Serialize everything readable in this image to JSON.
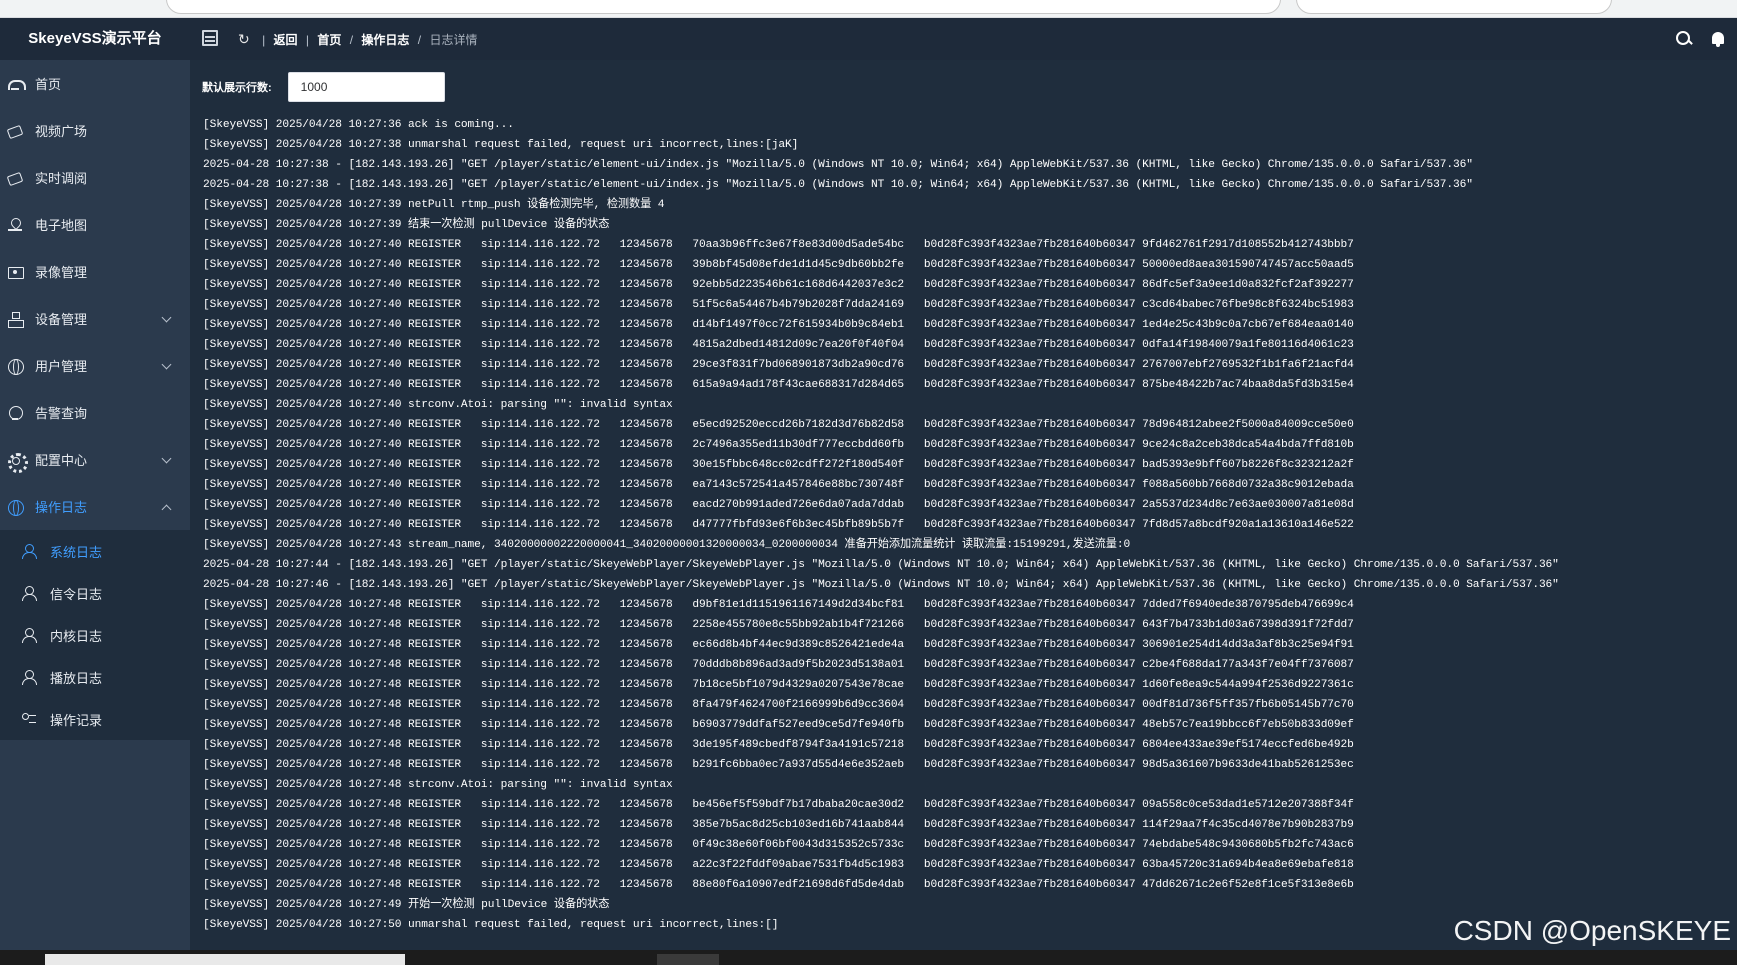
{
  "app": {
    "title": "SkeyeVSS演示平台"
  },
  "breadcrumb": {
    "back": "返回",
    "home": "首页",
    "section": "操作日志",
    "current": "日志详情",
    "sep": "/",
    "bar": "|"
  },
  "sidebar": {
    "items": [
      {
        "label": "首页",
        "icon": "dashboard-icon"
      },
      {
        "label": "视频广场",
        "icon": "video-icon"
      },
      {
        "label": "实时调阅",
        "icon": "video-icon"
      },
      {
        "label": "电子地图",
        "icon": "map-pin-icon"
      },
      {
        "label": "录像管理",
        "icon": "record-icon"
      },
      {
        "label": "设备管理",
        "icon": "device-icon"
      },
      {
        "label": "用户管理",
        "icon": "globe-icon"
      },
      {
        "label": "告警查询",
        "icon": "alarm-icon"
      },
      {
        "label": "配置中心",
        "icon": "gear-icon"
      },
      {
        "label": "操作日志",
        "icon": "globe-icon"
      }
    ],
    "submenu": [
      {
        "label": "系统日志",
        "icon": "user-icon"
      },
      {
        "label": "信令日志",
        "icon": "user-icon"
      },
      {
        "label": "内核日志",
        "icon": "user-icon"
      },
      {
        "label": "播放日志",
        "icon": "user-icon"
      },
      {
        "label": "操作记录",
        "icon": "list-icon"
      }
    ]
  },
  "rows": {
    "label": "默认展示行数:",
    "value": "1000"
  },
  "log_lines": [
    "[SkeyeVSS] 2025/04/28 10:27:36 ack is coming...",
    "[SkeyeVSS] 2025/04/28 10:27:38 unmarshal request failed, request uri incorrect,lines:[jaK]",
    "2025-04-28 10:27:38 - [182.143.193.26] \"GET /player/static/element-ui/index.js \"Mozilla/5.0 (Windows NT 10.0; Win64; x64) AppleWebKit/537.36 (KHTML, like Gecko) Chrome/135.0.0.0 Safari/537.36\"",
    "2025-04-28 10:27:38 - [182.143.193.26] \"GET /player/static/element-ui/index.js \"Mozilla/5.0 (Windows NT 10.0; Win64; x64) AppleWebKit/537.36 (KHTML, like Gecko) Chrome/135.0.0.0 Safari/537.36\"",
    "[SkeyeVSS] 2025/04/28 10:27:39 netPull rtmp_push 设备检测完毕, 检测数量 4",
    "[SkeyeVSS] 2025/04/28 10:27:39 结束一次检测 pullDevice 设备的状态",
    "[SkeyeVSS] 2025/04/28 10:27:40 REGISTER   sip:114.116.122.72   12345678   70aa3b96ffc3e67f8e83d00d5ade54bc   b0d28fc393f4323ae7fb281640b60347 9fd462761f2917d108552b412743bbb7",
    "[SkeyeVSS] 2025/04/28 10:27:40 REGISTER   sip:114.116.122.72   12345678   39b8bf45d08efde1d1d45c9db60bb2fe   b0d28fc393f4323ae7fb281640b60347 50000ed8aea301590747457acc50aad5",
    "[SkeyeVSS] 2025/04/28 10:27:40 REGISTER   sip:114.116.122.72   12345678   92ebb5d223546b61c168d6442037e3c2   b0d28fc393f4323ae7fb281640b60347 86dfc5ef3a9ee1d0a832fcf2af392277",
    "[SkeyeVSS] 2025/04/28 10:27:40 REGISTER   sip:114.116.122.72   12345678   51f5c6a54467b4b79b2028f7dda24169   b0d28fc393f4323ae7fb281640b60347 c3cd64babec76fbe98c8f6324bc51983",
    "[SkeyeVSS] 2025/04/28 10:27:40 REGISTER   sip:114.116.122.72   12345678   d14bf1497f0cc72f615934b0b9c84eb1   b0d28fc393f4323ae7fb281640b60347 1ed4e25c43b9c0a7cb67ef684eaa0140",
    "[SkeyeVSS] 2025/04/28 10:27:40 REGISTER   sip:114.116.122.72   12345678   4815a2dbed14812d09c7ea20f0f40f04   b0d28fc393f4323ae7fb281640b60347 0dfa14f19840079a1fe80116d4061c23",
    "[SkeyeVSS] 2025/04/28 10:27:40 REGISTER   sip:114.116.122.72   12345678   29ce3f831f7bd068901873db2a90cd76   b0d28fc393f4323ae7fb281640b60347 2767007ebf2769532f1b1fa6f21acfd4",
    "[SkeyeVSS] 2025/04/28 10:27:40 REGISTER   sip:114.116.122.72   12345678   615a9a94ad178f43cae688317d284d65   b0d28fc393f4323ae7fb281640b60347 875be48422b7ac74baa8da5fd3b315e4",
    "[SkeyeVSS] 2025/04/28 10:27:40 strconv.Atoi: parsing \"\": invalid syntax",
    "[SkeyeVSS] 2025/04/28 10:27:40 REGISTER   sip:114.116.122.72   12345678   e5ecd92520eccd26b7182d3d76b82d58   b0d28fc393f4323ae7fb281640b60347 78d964812abee2f5000a84009cce50e0",
    "[SkeyeVSS] 2025/04/28 10:27:40 REGISTER   sip:114.116.122.72   12345678   2c7496a355ed11b30df777eccbdd60fb   b0d28fc393f4323ae7fb281640b60347 9ce24c8a2ceb38dca54a4bda7ffd810b",
    "[SkeyeVSS] 2025/04/28 10:27:40 REGISTER   sip:114.116.122.72   12345678   30e15fbbc648cc02cdff272f180d540f   b0d28fc393f4323ae7fb281640b60347 bad5393e9bff607b8226f8c323212a2f",
    "[SkeyeVSS] 2025/04/28 10:27:40 REGISTER   sip:114.116.122.72   12345678   ea7143c572541a457846e88bc730748f   b0d28fc393f4323ae7fb281640b60347 f088a560bb7668d0732a38c9012ebada",
    "[SkeyeVSS] 2025/04/28 10:27:40 REGISTER   sip:114.116.122.72   12345678   eacd270b991aded726e6da07ada7ddab   b0d28fc393f4323ae7fb281640b60347 2a5537d234d8c7e63ae030007a81e08d",
    "[SkeyeVSS] 2025/04/28 10:27:40 REGISTER   sip:114.116.122.72   12345678   d47777fbfd93e6f6b3ec45bfb89b5b7f   b0d28fc393f4323ae7fb281640b60347 7fd8d57a8bcdf920a1a13610a146e522",
    "[SkeyeVSS] 2025/04/28 10:27:43 stream_name, 34020000002220000041_34020000001320000034_0200000034 准备开始添加流量统计 读取流量:15199291,发送流量:0",
    "2025-04-28 10:27:44 - [182.143.193.26] \"GET /player/static/SkeyeWebPlayer/SkeyeWebPlayer.js \"Mozilla/5.0 (Windows NT 10.0; Win64; x64) AppleWebKit/537.36 (KHTML, like Gecko) Chrome/135.0.0.0 Safari/537.36\"",
    "2025-04-28 10:27:46 - [182.143.193.26] \"GET /player/static/SkeyeWebPlayer/SkeyeWebPlayer.js \"Mozilla/5.0 (Windows NT 10.0; Win64; x64) AppleWebKit/537.36 (KHTML, like Gecko) Chrome/135.0.0.0 Safari/537.36\"",
    "[SkeyeVSS] 2025/04/28 10:27:48 REGISTER   sip:114.116.122.72   12345678   d9bf81e1d1151961167149d2d34bcf81   b0d28fc393f4323ae7fb281640b60347 7dded7f6940ede3870795deb476699c4",
    "[SkeyeVSS] 2025/04/28 10:27:48 REGISTER   sip:114.116.122.72   12345678   2258e455780e8c55bb92ab1b4f721266   b0d28fc393f4323ae7fb281640b60347 643f7b4733b1d03a67398d391f72fdd7",
    "[SkeyeVSS] 2025/04/28 10:27:48 REGISTER   sip:114.116.122.72   12345678   ec66d8b4bf44ec9d389c8526421ede4a   b0d28fc393f4323ae7fb281640b60347 306901e254d14dd3a3af8b3c25e94f91",
    "[SkeyeVSS] 2025/04/28 10:27:48 REGISTER   sip:114.116.122.72   12345678   70dddb8b896ad3ad9f5b2023d5138a01   b0d28fc393f4323ae7fb281640b60347 c2be4f688da177a343f7e04ff7376087",
    "[SkeyeVSS] 2025/04/28 10:27:48 REGISTER   sip:114.116.122.72   12345678   7b18ce5bf1079d4329a0207543e78cae   b0d28fc393f4323ae7fb281640b60347 1d60fe8ea9c544a994f2536d9227361c",
    "[SkeyeVSS] 2025/04/28 10:27:48 REGISTER   sip:114.116.122.72   12345678   8fa479f4624700f2166999b6d9cc3604   b0d28fc393f4323ae7fb281640b60347 00df81d736f5ff357fb6b05145b77c70",
    "[SkeyeVSS] 2025/04/28 10:27:48 REGISTER   sip:114.116.122.72   12345678   b6903779ddfaf527eed9ce5d7fe940fb   b0d28fc393f4323ae7fb281640b60347 48eb57c7ea19bbcc6f7eb50b833d09ef",
    "[SkeyeVSS] 2025/04/28 10:27:48 REGISTER   sip:114.116.122.72   12345678   3de195f489cbedf8794f3a4191c57218   b0d28fc393f4323ae7fb281640b60347 6804ee433ae39ef5174eccfed6be492b",
    "[SkeyeVSS] 2025/04/28 10:27:48 REGISTER   sip:114.116.122.72   12345678   b291fc6bba0ec7a937d55d4e6e352aeb   b0d28fc393f4323ae7fb281640b60347 98d5a361607b9633de41bab5261253ec",
    "[SkeyeVSS] 2025/04/28 10:27:48 strconv.Atoi: parsing \"\": invalid syntax",
    "[SkeyeVSS] 2025/04/28 10:27:48 REGISTER   sip:114.116.122.72   12345678   be456ef5f59bdf7b17dbaba20cae30d2   b0d28fc393f4323ae7fb281640b60347 09a558c0ce53dad1e5712e207388f34f",
    "[SkeyeVSS] 2025/04/28 10:27:48 REGISTER   sip:114.116.122.72   12345678   385e7b5ac8d25cb103ed16b741aab844   b0d28fc393f4323ae7fb281640b60347 114f29aa7f4c35cd4078e7b90b2837b9",
    "[SkeyeVSS] 2025/04/28 10:27:48 REGISTER   sip:114.116.122.72   12345678   0f49c38e60f06bf0043d315352c5733c   b0d28fc393f4323ae7fb281640b60347 74ebdabe548c9430680b5fb2fc743ac6",
    "[SkeyeVSS] 2025/04/28 10:27:48 REGISTER   sip:114.116.122.72   12345678   a22c3f22fddf09abae7531fb4d5c1983   b0d28fc393f4323ae7fb281640b60347 63ba45720c31a694b4ea8e69ebafe818",
    "[SkeyeVSS] 2025/04/28 10:27:48 REGISTER   sip:114.116.122.72   12345678   88e80f6a10907edf21698d6fd5de4dab   b0d28fc393f4323ae7fb281640b60347 47dd62671c2e6f52e8f1ce5f313e8e6b",
    "[SkeyeVSS] 2025/04/28 10:27:49 开始一次检测 pullDevice 设备的状态",
    "[SkeyeVSS] 2025/04/28 10:27:50 unmarshal request failed, request uri incorrect,lines:[]"
  ],
  "watermark": "CSDN @OpenSKEYE",
  "colors": {
    "topbar": "#1e2a3a",
    "sidebar": "#2b3a4d",
    "main": "#1f2d3d",
    "accent": "#409eff"
  }
}
